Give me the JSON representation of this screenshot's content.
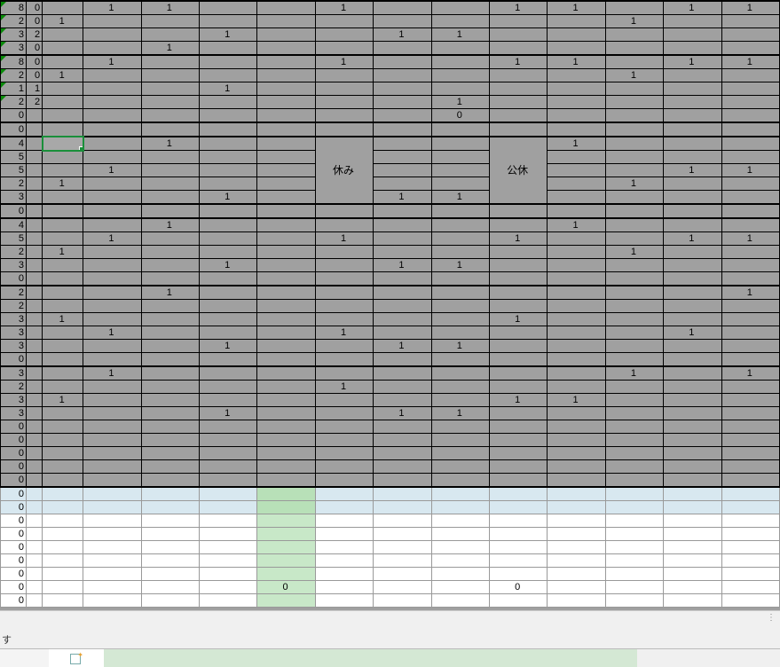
{
  "labels": {
    "yasumi": "休み",
    "koukyu": "公休",
    "status_suffix": "す"
  },
  "rows": [
    {
      "a": "8",
      "b": "0",
      "v": [
        "",
        "1",
        "1",
        "",
        "",
        "1",
        "",
        "",
        "1",
        "1",
        "",
        "1",
        "1"
      ],
      "top": true,
      "tri": true
    },
    {
      "a": "2",
      "b": "0",
      "v": [
        "1",
        "",
        "",
        "",
        "",
        "",
        "",
        "",
        "",
        "",
        "1",
        "",
        ""
      ],
      "tri": true
    },
    {
      "a": "3",
      "b": "2",
      "v": [
        "",
        "",
        "",
        "1",
        "",
        "",
        "1",
        "1",
        "",
        "",
        "",
        "",
        ""
      ],
      "tri": true
    },
    {
      "a": "3",
      "b": "0",
      "v": [
        "",
        "",
        "1",
        "",
        "",
        "",
        "",
        "",
        "",
        "",
        "",
        "",
        ""
      ],
      "bottom": true,
      "tri": true
    },
    {
      "a": "8",
      "b": "0",
      "v": [
        "",
        "1",
        "",
        "",
        "",
        "1",
        "",
        "",
        "1",
        "1",
        "",
        "1",
        "1"
      ],
      "top": true,
      "tri": true
    },
    {
      "a": "2",
      "b": "0",
      "v": [
        "1",
        "",
        "",
        "",
        "",
        "",
        "",
        "",
        "",
        "",
        "1",
        "",
        ""
      ],
      "tri": true
    },
    {
      "a": "1",
      "b": "1",
      "v": [
        "",
        "",
        "",
        "1",
        "",
        "",
        "",
        "",
        "",
        "",
        "",
        "",
        ""
      ],
      "tri": true
    },
    {
      "a": "2",
      "b": "2",
      "v": [
        "",
        "",
        "",
        "",
        "",
        "",
        "",
        "1",
        "",
        "",
        "",
        "",
        ""
      ],
      "tri": true
    },
    {
      "a": "0",
      "b": "",
      "v": [
        "",
        "",
        "",
        "",
        "",
        "",
        "",
        "0",
        "",
        "",
        "",
        "",
        ""
      ],
      "bottom": true
    },
    {
      "a": "0",
      "b": "",
      "v": [
        "",
        "",
        "",
        "",
        "",
        "",
        "",
        "",
        "",
        "",
        "",
        "",
        ""
      ],
      "top": true,
      "bottom": true
    },
    {
      "a": "4",
      "b": "",
      "v": [
        "",
        "",
        "1",
        "",
        "",
        "",
        "",
        "",
        "",
        "1",
        "",
        "",
        ""
      ],
      "top": true,
      "sel": true
    },
    {
      "a": "5",
      "b": "",
      "v": [
        "",
        "",
        "",
        "",
        "",
        "",
        "",
        "",
        "",
        "",
        "",
        "",
        ""
      ]
    },
    {
      "a": "5",
      "b": "",
      "v": [
        "",
        "1",
        "",
        "",
        "",
        "",
        "",
        "",
        "",
        "",
        "",
        "1",
        "1"
      ]
    },
    {
      "a": "2",
      "b": "",
      "v": [
        "1",
        "",
        "",
        "",
        "",
        "",
        "",
        "",
        "",
        "",
        "1",
        "",
        ""
      ]
    },
    {
      "a": "3",
      "b": "",
      "v": [
        "",
        "",
        "",
        "1",
        "",
        "",
        "1",
        "1",
        "",
        "",
        "",
        "",
        ""
      ],
      "bottom": true
    },
    {
      "a": "0",
      "b": "",
      "v": [
        "",
        "",
        "",
        "",
        "",
        "",
        "",
        "",
        "",
        "",
        "",
        "",
        ""
      ],
      "top": true,
      "bottom": true
    },
    {
      "a": "4",
      "b": "",
      "v": [
        "",
        "",
        "1",
        "",
        "",
        "",
        "",
        "",
        "",
        "1",
        "",
        "",
        ""
      ],
      "top": true
    },
    {
      "a": "5",
      "b": "",
      "v": [
        "",
        "1",
        "",
        "",
        "",
        "1",
        "",
        "",
        "1",
        "",
        "",
        "1",
        "1"
      ]
    },
    {
      "a": "2",
      "b": "",
      "v": [
        "1",
        "",
        "",
        "",
        "",
        "",
        "",
        "",
        "",
        "",
        "1",
        "",
        ""
      ]
    },
    {
      "a": "3",
      "b": "",
      "v": [
        "",
        "",
        "",
        "1",
        "",
        "",
        "1",
        "1",
        "",
        "",
        "",
        "",
        ""
      ]
    },
    {
      "a": "0",
      "b": "",
      "v": [
        "",
        "",
        "",
        "",
        "",
        "",
        "",
        "",
        "",
        "",
        "",
        "",
        ""
      ],
      "bottom": true
    },
    {
      "a": "2",
      "b": "",
      "v": [
        "",
        "",
        "1",
        "",
        "",
        "",
        "",
        "",
        "",
        "",
        "",
        "",
        "1"
      ],
      "top": true
    },
    {
      "a": "2",
      "b": "",
      "v": [
        "",
        "",
        "",
        "",
        "",
        "",
        "",
        "",
        "",
        "",
        "",
        "",
        ""
      ]
    },
    {
      "a": "3",
      "b": "",
      "v": [
        "1",
        "",
        "",
        "",
        "",
        "",
        "",
        "",
        "1",
        "",
        "",
        "",
        ""
      ]
    },
    {
      "a": "3",
      "b": "",
      "v": [
        "",
        "1",
        "",
        "",
        "",
        "1",
        "",
        "",
        "",
        "",
        "",
        "1",
        ""
      ]
    },
    {
      "a": "3",
      "b": "",
      "v": [
        "",
        "",
        "",
        "1",
        "",
        "",
        "1",
        "1",
        "",
        "",
        "",
        "",
        ""
      ]
    },
    {
      "a": "0",
      "b": "",
      "v": [
        "",
        "",
        "",
        "",
        "",
        "",
        "",
        "",
        "",
        "",
        "",
        "",
        ""
      ],
      "bottom": true
    },
    {
      "a": "3",
      "b": "",
      "v": [
        "",
        "1",
        "",
        "",
        "",
        "",
        "",
        "",
        "",
        "",
        "1",
        "",
        "1"
      ],
      "top": true
    },
    {
      "a": "2",
      "b": "",
      "v": [
        "",
        "",
        "",
        "",
        "",
        "1",
        "",
        "",
        "",
        "",
        "",
        "",
        ""
      ]
    },
    {
      "a": "3",
      "b": "",
      "v": [
        "1",
        "",
        "",
        "",
        "",
        "",
        "",
        "",
        "1",
        "1",
        "",
        "",
        ""
      ]
    },
    {
      "a": "3",
      "b": "",
      "v": [
        "",
        "",
        "",
        "1",
        "",
        "",
        "1",
        "1",
        "",
        "",
        "",
        "",
        ""
      ]
    },
    {
      "a": "0",
      "b": "",
      "v": [
        "",
        "",
        "",
        "",
        "",
        "",
        "",
        "",
        "",
        "",
        "",
        "",
        ""
      ]
    },
    {
      "a": "0",
      "b": "",
      "v": [
        "",
        "",
        "",
        "",
        "",
        "",
        "",
        "",
        "",
        "",
        "",
        "",
        ""
      ]
    },
    {
      "a": "0",
      "b": "",
      "v": [
        "",
        "",
        "",
        "",
        "",
        "",
        "",
        "",
        "",
        "",
        "",
        "",
        ""
      ]
    },
    {
      "a": "0",
      "b": "",
      "v": [
        "",
        "",
        "",
        "",
        "",
        "",
        "",
        "",
        "",
        "",
        "",
        "",
        ""
      ]
    },
    {
      "a": "0",
      "b": "",
      "v": [
        "",
        "",
        "",
        "",
        "",
        "",
        "",
        "",
        "",
        "",
        "",
        "",
        ""
      ],
      "bottom": true
    },
    {
      "a": "0",
      "b": "",
      "v": [
        "",
        "",
        "",
        "",
        "",
        "",
        "",
        "",
        "",
        "",
        "",
        "",
        ""
      ],
      "blue": true
    },
    {
      "a": "0",
      "b": "",
      "v": [
        "",
        "",
        "",
        "",
        "",
        "",
        "",
        "",
        "",
        "",
        "",
        "",
        ""
      ],
      "blue": true
    },
    {
      "a": "0",
      "b": "",
      "v": [
        "",
        "",
        "",
        "",
        "",
        "",
        "",
        "",
        "",
        "",
        "",
        "",
        ""
      ],
      "white": true
    },
    {
      "a": "0",
      "b": "",
      "v": [
        "",
        "",
        "",
        "",
        "",
        "",
        "",
        "",
        "",
        "",
        "",
        "",
        ""
      ],
      "white": true
    },
    {
      "a": "0",
      "b": "",
      "v": [
        "",
        "",
        "",
        "",
        "",
        "",
        "",
        "",
        "",
        "",
        "",
        "",
        ""
      ],
      "white": true
    },
    {
      "a": "0",
      "b": "",
      "v": [
        "",
        "",
        "",
        "",
        "",
        "",
        "",
        "",
        "",
        "",
        "",
        "",
        ""
      ],
      "white": true
    },
    {
      "a": "0",
      "b": "",
      "v": [
        "",
        "",
        "",
        "",
        "",
        "",
        "",
        "",
        "",
        "",
        "",
        "",
        ""
      ],
      "white": true
    },
    {
      "a": "0",
      "b": "",
      "v": [
        "",
        "",
        "",
        "",
        "0",
        "",
        "",
        "",
        "0",
        "",
        "",
        "",
        ""
      ],
      "white": true
    },
    {
      "a": "0",
      "b": "",
      "v": [
        "",
        "",
        "",
        "",
        "",
        "",
        "",
        "",
        "",
        "",
        "",
        "",
        ""
      ],
      "white": true,
      "half": true
    }
  ],
  "merge_yasumi": {
    "row_start": 10,
    "row_end": 14,
    "col": 5
  },
  "merge_koukyu": {
    "row_start": 10,
    "row_end": 14,
    "col": 8
  }
}
